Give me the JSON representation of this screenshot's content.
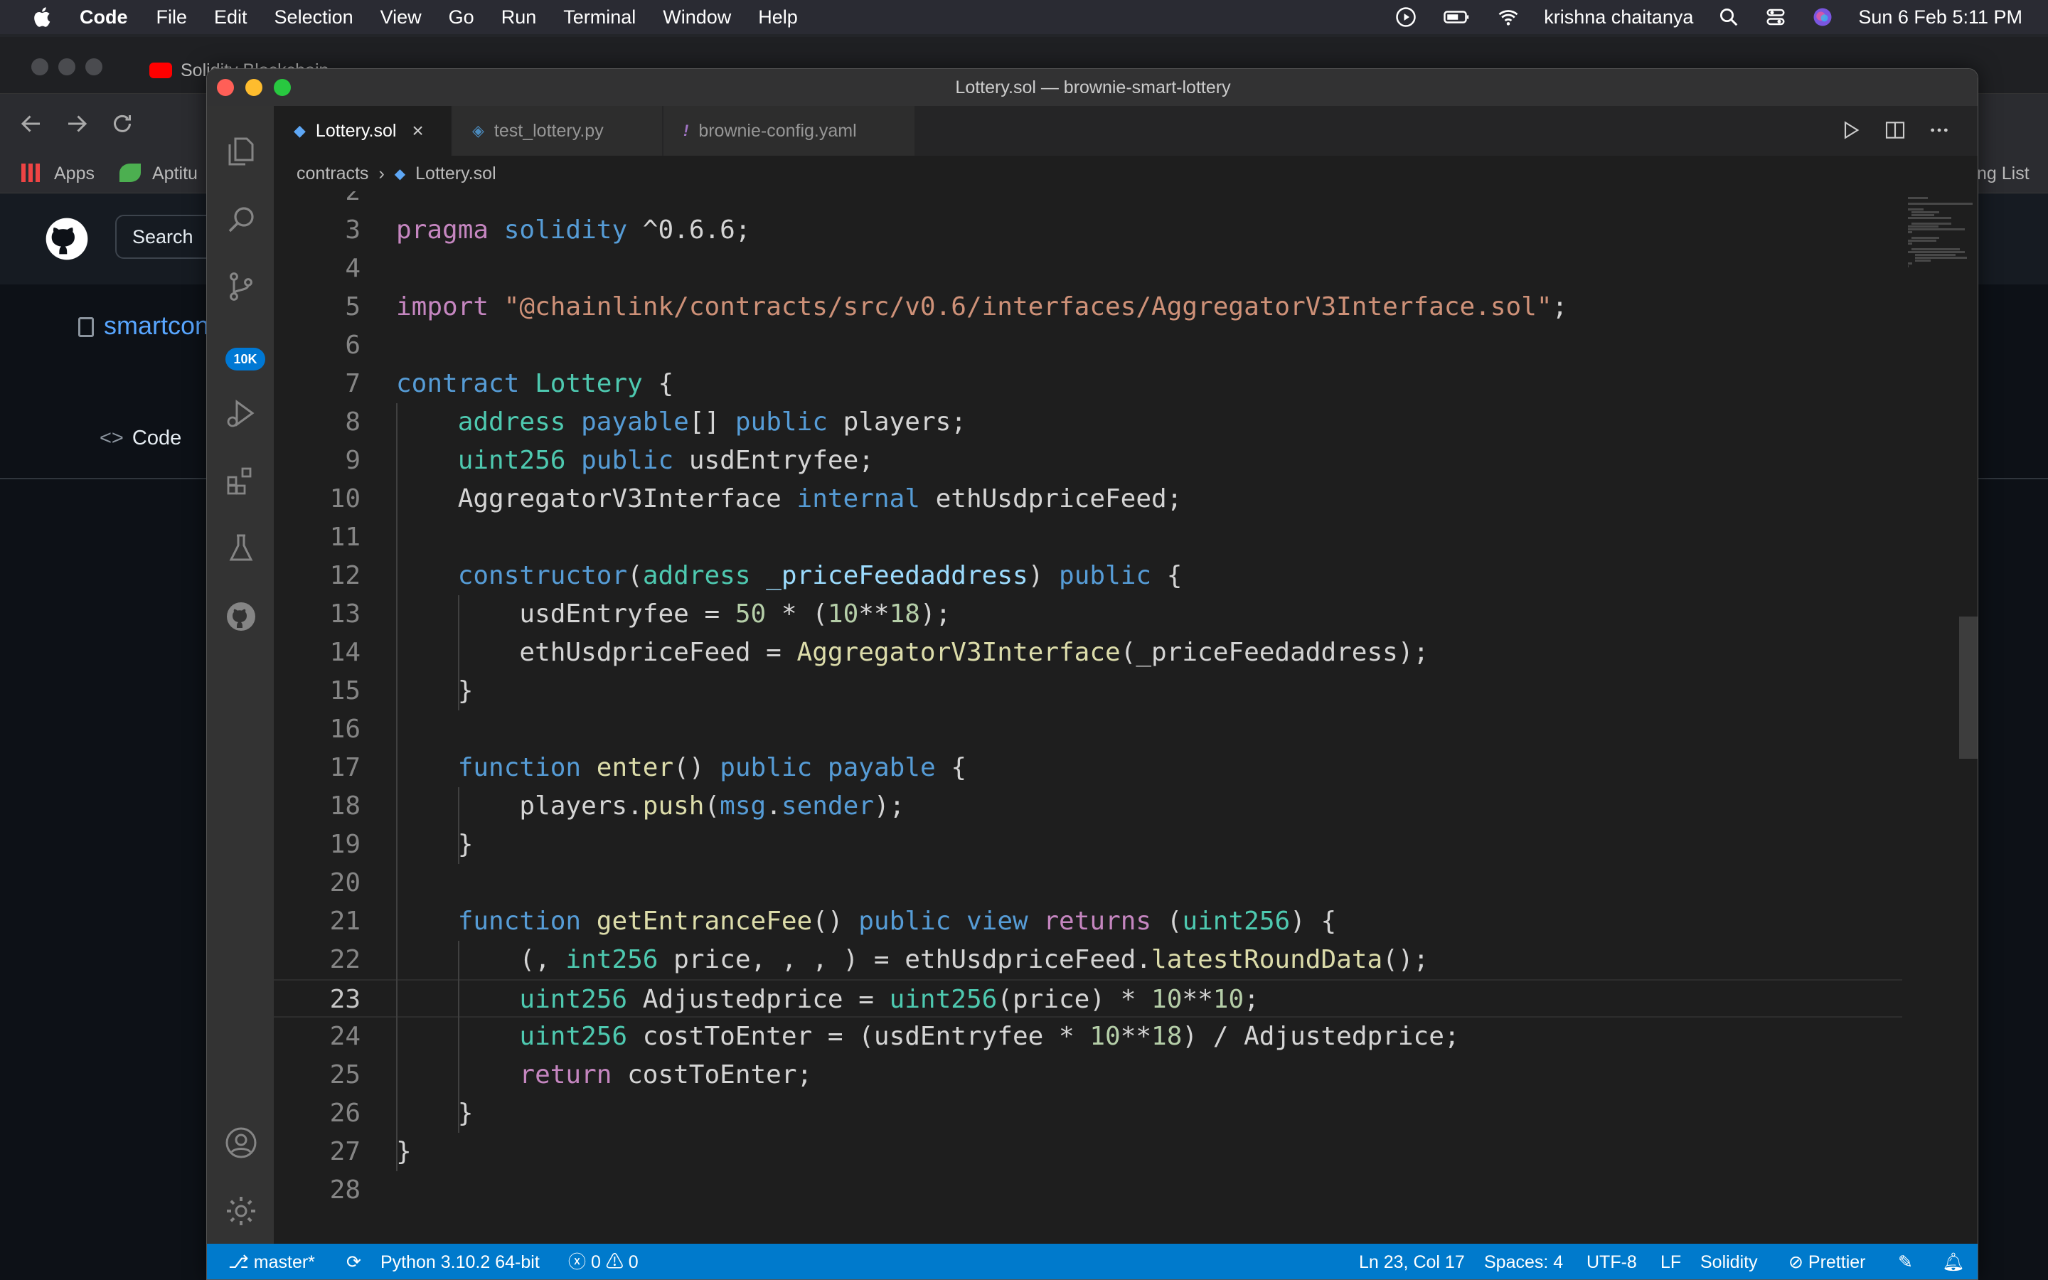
{
  "menubar": {
    "app": "Code",
    "items": [
      "File",
      "Edit",
      "Selection",
      "View",
      "Go",
      "Run",
      "Terminal",
      "Window",
      "Help"
    ],
    "user": "krishna chaitanya",
    "datetime": "Sun 6 Feb  5:11 PM"
  },
  "browser": {
    "tabs": [
      "Solidity Blockchain..."
    ],
    "bookmarks": [
      "Apps",
      "Aptitu",
      "ng List"
    ],
    "search_label": "Search",
    "repo_name": "smartcont",
    "code_tab": "Code"
  },
  "window": {
    "title": "Lottery.sol — brownie-smart-lottery",
    "badge": "10K"
  },
  "tabs": [
    {
      "label": "Lottery.sol",
      "icon": "solidity-icon"
    },
    {
      "label": "test_lottery.py",
      "icon": "python-icon"
    },
    {
      "label": "brownie-config.yaml",
      "icon": "yaml-icon"
    }
  ],
  "breadcrumb": {
    "folder": "contracts",
    "file": "Lottery.sol"
  },
  "code_lines": [
    {
      "n": "2",
      "tokens": []
    },
    {
      "n": "3",
      "tokens": [
        [
          "kw",
          "pragma"
        ],
        [
          "pl",
          " "
        ],
        [
          "st",
          "solidity"
        ],
        [
          "pl",
          " ^0.6.6;"
        ]
      ]
    },
    {
      "n": "4",
      "tokens": []
    },
    {
      "n": "5",
      "tokens": [
        [
          "kw",
          "import"
        ],
        [
          "pl",
          " "
        ],
        [
          "str",
          "\"@chainlink/contracts/src/v0.6/interfaces/AggregatorV3Interface.sol\""
        ],
        [
          "pl",
          ";"
        ]
      ]
    },
    {
      "n": "6",
      "tokens": []
    },
    {
      "n": "7",
      "tokens": [
        [
          "st",
          "contract"
        ],
        [
          "pl",
          " "
        ],
        [
          "ty",
          "Lottery"
        ],
        [
          "pl",
          " {"
        ]
      ]
    },
    {
      "n": "8",
      "tokens": [
        [
          "pl",
          "    "
        ],
        [
          "ty",
          "address"
        ],
        [
          "pl",
          " "
        ],
        [
          "st",
          "payable"
        ],
        [
          "pl",
          "[] "
        ],
        [
          "st",
          "public"
        ],
        [
          "pl",
          " players;"
        ]
      ]
    },
    {
      "n": "9",
      "tokens": [
        [
          "pl",
          "    "
        ],
        [
          "ty",
          "uint256"
        ],
        [
          "pl",
          " "
        ],
        [
          "st",
          "public"
        ],
        [
          "pl",
          " usdEntryfee;"
        ]
      ]
    },
    {
      "n": "10",
      "tokens": [
        [
          "pl",
          "    AggregatorV3Interface "
        ],
        [
          "st",
          "internal"
        ],
        [
          "pl",
          " ethUsdpriceFeed;"
        ]
      ]
    },
    {
      "n": "11",
      "tokens": []
    },
    {
      "n": "12",
      "tokens": [
        [
          "pl",
          "    "
        ],
        [
          "st",
          "constructor"
        ],
        [
          "pl",
          "("
        ],
        [
          "ty",
          "address"
        ],
        [
          "pl",
          " "
        ],
        [
          "var",
          "_priceFeedaddress"
        ],
        [
          "pl",
          ") "
        ],
        [
          "st",
          "public"
        ],
        [
          "pl",
          " {"
        ]
      ]
    },
    {
      "n": "13",
      "tokens": [
        [
          "pl",
          "        usdEntryfee = "
        ],
        [
          "num",
          "50"
        ],
        [
          "pl",
          " * ("
        ],
        [
          "num",
          "10"
        ],
        [
          "pl",
          "**"
        ],
        [
          "num",
          "18"
        ],
        [
          "pl",
          ");"
        ]
      ]
    },
    {
      "n": "14",
      "tokens": [
        [
          "pl",
          "        ethUsdpriceFeed = "
        ],
        [
          "fn",
          "AggregatorV3Interface"
        ],
        [
          "pl",
          "(_priceFeedaddress);"
        ]
      ]
    },
    {
      "n": "15",
      "tokens": [
        [
          "pl",
          "    }"
        ]
      ]
    },
    {
      "n": "16",
      "tokens": []
    },
    {
      "n": "17",
      "tokens": [
        [
          "pl",
          "    "
        ],
        [
          "st",
          "function"
        ],
        [
          "pl",
          " "
        ],
        [
          "fn",
          "enter"
        ],
        [
          "pl",
          "() "
        ],
        [
          "st",
          "public"
        ],
        [
          "pl",
          " "
        ],
        [
          "st",
          "payable"
        ],
        [
          "pl",
          " {"
        ]
      ]
    },
    {
      "n": "18",
      "tokens": [
        [
          "pl",
          "        players."
        ],
        [
          "fn",
          "push"
        ],
        [
          "pl",
          "("
        ],
        [
          "st",
          "msg"
        ],
        [
          "pl",
          "."
        ],
        [
          "st",
          "sender"
        ],
        [
          "pl",
          ");"
        ]
      ]
    },
    {
      "n": "19",
      "tokens": [
        [
          "pl",
          "    }"
        ]
      ]
    },
    {
      "n": "20",
      "tokens": []
    },
    {
      "n": "21",
      "tokens": [
        [
          "pl",
          "    "
        ],
        [
          "st",
          "function"
        ],
        [
          "pl",
          " "
        ],
        [
          "fn",
          "getEntranceFee"
        ],
        [
          "pl",
          "() "
        ],
        [
          "st",
          "public"
        ],
        [
          "pl",
          " "
        ],
        [
          "st",
          "view"
        ],
        [
          "pl",
          " "
        ],
        [
          "kw",
          "returns"
        ],
        [
          "pl",
          " ("
        ],
        [
          "ty",
          "uint256"
        ],
        [
          "pl",
          ") {"
        ]
      ]
    },
    {
      "n": "22",
      "tokens": [
        [
          "pl",
          "        (, "
        ],
        [
          "ty",
          "int256"
        ],
        [
          "pl",
          " price, , , ) = ethUsdpriceFeed."
        ],
        [
          "fn",
          "latestRoundData"
        ],
        [
          "pl",
          "();"
        ]
      ]
    },
    {
      "n": "23",
      "tokens": [
        [
          "pl",
          "        "
        ],
        [
          "ty",
          "uint256"
        ],
        [
          "pl",
          " Adjustedprice = "
        ],
        [
          "ty",
          "uint256"
        ],
        [
          "pl",
          "(price) * "
        ],
        [
          "num",
          "10"
        ],
        [
          "pl",
          "**"
        ],
        [
          "num",
          "10"
        ],
        [
          "pl",
          ";"
        ]
      ]
    },
    {
      "n": "24",
      "tokens": [
        [
          "pl",
          "        "
        ],
        [
          "ty",
          "uint256"
        ],
        [
          "pl",
          " costToEnter = (usdEntryfee * "
        ],
        [
          "num",
          "10"
        ],
        [
          "pl",
          "**"
        ],
        [
          "num",
          "18"
        ],
        [
          "pl",
          ") / Adjustedprice;"
        ]
      ]
    },
    {
      "n": "25",
      "tokens": [
        [
          "pl",
          "        "
        ],
        [
          "kw",
          "return"
        ],
        [
          "pl",
          " costToEnter;"
        ]
      ]
    },
    {
      "n": "26",
      "tokens": [
        [
          "pl",
          "    }"
        ]
      ]
    },
    {
      "n": "27",
      "tokens": [
        [
          "pl",
          "}"
        ]
      ]
    },
    {
      "n": "28",
      "tokens": []
    }
  ],
  "current_line": "23",
  "status": {
    "branch": "master*",
    "python": "Python 3.10.2 64-bit",
    "errors": "0",
    "warnings": "0",
    "position": "Ln 23, Col 17",
    "spaces": "Spaces: 4",
    "encoding": "UTF-8",
    "eol": "LF",
    "language": "Solidity",
    "formatter": "Prettier"
  },
  "colors": {
    "statusbar": "#007acc",
    "keyword": "#c586c0",
    "storage": "#569cd6",
    "type": "#4ec9b0",
    "function": "#dcdcaa",
    "string": "#ce9178",
    "number": "#b5cea8"
  }
}
